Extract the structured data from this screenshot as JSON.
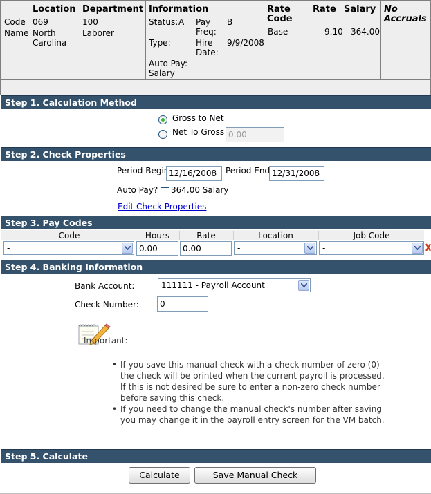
{
  "summary": {
    "location_header": "Location",
    "department_header": "Department",
    "information_header": "Information",
    "code_label": "Code",
    "name_label": "Name",
    "location_code": "069",
    "location_name_line1": "North",
    "location_name_line2": "Carolina",
    "department_code": "100",
    "department_name": "Laborer",
    "status_label": "Status:",
    "status_value": "A",
    "payfreq_label_line1": "Pay",
    "payfreq_label_line2": "Freq:",
    "payfreq_value": "B",
    "type_label": "Type:",
    "hire_label_line1": "Hire",
    "hire_label_line2": "Date:",
    "hire_value": "9/9/2008",
    "autopay_label_line1": "Auto Pay:",
    "autopay_label_line2": "Salary",
    "rate_code_header_line1": "Rate",
    "rate_code_header_line2": "Code",
    "rate_header": "Rate",
    "salary_header": "Salary",
    "rate_code": "Base",
    "rate_value": "9.10",
    "salary_value": "364.00",
    "accruals_line1": "No",
    "accruals_line2": "Accruals"
  },
  "step1": {
    "title": "Step 1. Calculation Method",
    "option_gross": "Gross to Net",
    "option_net": "Net To Gross",
    "net_value": "0.00"
  },
  "step2": {
    "title": "Step 2. Check Properties",
    "period_begin_label": "Period Begin",
    "period_begin_value": "12/16/2008",
    "period_end_label": "Period End",
    "period_end_value": "12/31/2008",
    "autopay_label": "Auto Pay?",
    "autopay_text": "364.00 Salary",
    "edit_link": "Edit Check Properties"
  },
  "step3": {
    "title": "Step 3. Pay Codes",
    "columns": [
      "Code",
      "Hours",
      "Rate",
      "Location",
      "Job Code"
    ],
    "code_value": "-",
    "hours_value": "0.00",
    "rate_value": "0.00",
    "location_value": "-",
    "jobcode_value": "-"
  },
  "step4": {
    "title": "Step 4. Banking Information",
    "bank_label": "Bank Account:",
    "bank_value": "111111 - Payroll Account",
    "check_label": "Check Number:",
    "check_value": "0",
    "important_label": "Important:",
    "note1_lines": [
      "If you save this manual check with a check number of zero (0)",
      "the check will be printed when the current payroll is processed.",
      "If this is not desired be sure to enter a non-zero check number",
      "before saving this check."
    ],
    "note2_lines": [
      "If you need to change the manual check's number after saving",
      "you may change it in the payroll entry screen for the VM batch."
    ]
  },
  "step5": {
    "title": "Step 5. Calculate",
    "calculate_button": "Calculate",
    "save_button": "Save Manual Check"
  }
}
